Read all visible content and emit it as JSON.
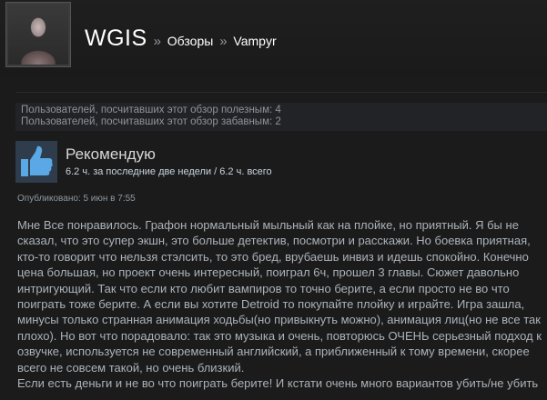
{
  "header": {
    "username": "WGIS",
    "separator": "»",
    "crumb_reviews": "Обзоры",
    "crumb_game": "Vampyr"
  },
  "votes": {
    "helpful": "Пользователей, посчитавших этот обзор полезным: 4",
    "funny": "Пользователей, посчитавших этот обзор забавным: 2"
  },
  "review": {
    "recommendation": "Рекомендую",
    "hours": "6.2 ч. за последние две недели / 6.2 ч. всего",
    "posted": "Опубликовано: 5 июн в 7:55",
    "body": "Мне Все понравилось. Графон нормальный мыльный как на плойке, но приятный. Я бы не сказал, что это супер экшн, это больше детектив, посмотри и расскажи. Но боевка приятная, кто-то говорит что нельзя стэлсить, то это бред, врубаешь инвиз и идешь спокойно. Конечно цена большая, но проект очень интересный, поиграл 6ч, прошел 3 главы. Сюжет давольно интригующий. Так что если кто любит вампиров то точно берите, а если просто не во что поиграть тоже берите. А если вы хотите Detroid то покупайте плойку и играйте. Игра зашла, минусы только странная анимация ходьбы(но привыкнуть можно), анимация лиц(но не все так плохо). Но вот что порадовало: так это музыка и очень, повторюсь ОЧЕНЬ серьезный подход к озвучке, используется не современный английский, а приближенный к тому времени, скорее всего не совсем такой, но очень близкий.",
    "body_last": "Если есть деньги и не во что поиграть берите! И кстати очень много вариантов убить/не убить"
  },
  "colors": {
    "background": "#1b1b1b",
    "thumb_box": "#2f3c4c",
    "thumb_icon": "#5aa9e6"
  },
  "icons": [
    "thumbs-up-icon"
  ]
}
